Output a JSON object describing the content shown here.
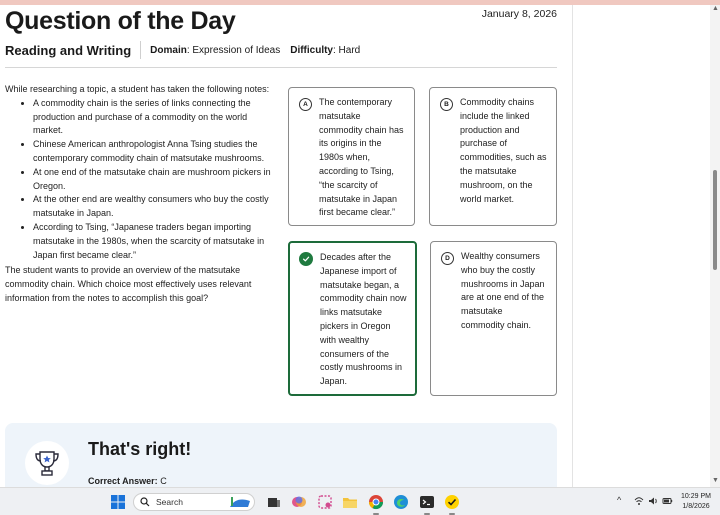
{
  "page": {
    "title": "Question of the Day",
    "date": "January 8, 2026",
    "section": "Reading and Writing",
    "domain_label": "Domain",
    "domain_value": ": Expression of Ideas",
    "difficulty_label": "Difficulty",
    "difficulty_value": ": Hard"
  },
  "passage": {
    "intro": "While researching a topic, a student has taken the following notes:",
    "notes": [
      "A commodity chain is the series of links connecting the production and purchase of a commodity on the world market.",
      "Chinese American anthropologist Anna Tsing studies the contemporary commodity chain of matsutake mushrooms.",
      "At one end of the matsutake chain are mushroom pickers in Oregon.",
      "At the other end are wealthy consumers who buy the costly matsutake in Japan.",
      "According to Tsing, “Japanese traders began importing matsutake in the 1980s, when the scarcity of matsutake in Japan first became clear.”"
    ],
    "question": "The student wants to provide an overview of the matsutake commodity chain. Which choice most effectively uses relevant information from the notes to accomplish this goal?"
  },
  "choices": [
    {
      "letter": "A",
      "text": "The contemporary matsutake commodity chain has its origins in the 1980s when, according to Tsing, “the scarcity of matsutake in Japan first became clear.”"
    },
    {
      "letter": "B",
      "text": "Commodity chains include the linked production and purchase of commodities, such as the matsutake mushroom, on the world market."
    },
    {
      "letter": "C",
      "text": "Decades after the Japanese import of matsutake began, a commodity chain now links matsutake pickers in Oregon with wealthy consumers of the costly mushrooms in Japan."
    },
    {
      "letter": "D",
      "text": "Wealthy consumers who buy the costly mushrooms in Japan are at one end of the matsutake commodity chain."
    }
  ],
  "feedback": {
    "title": "That's right!",
    "answer_label": "Correct Answer:",
    "answer_value": " C"
  },
  "taskbar": {
    "search_placeholder": "Search",
    "time": "10:29 PM",
    "date": "1/8/2026"
  },
  "colors": {
    "correct": "#1f7a3f",
    "feedback_bg": "#eef4fa",
    "top_strip": "#f0c8c0"
  }
}
